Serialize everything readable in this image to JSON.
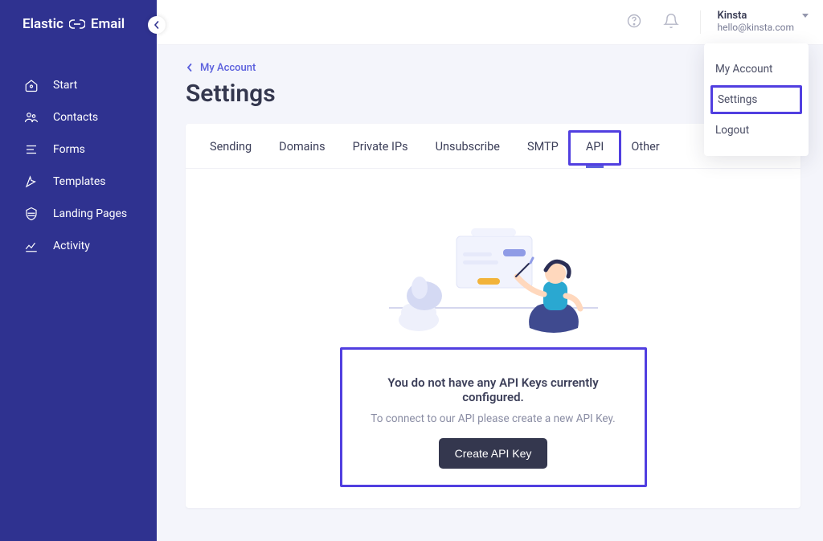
{
  "brand": {
    "name_a": "Elastic",
    "name_b": "Email"
  },
  "sidebar": {
    "items": [
      {
        "label": "Start",
        "icon": "home-icon"
      },
      {
        "label": "Contacts",
        "icon": "contacts-icon"
      },
      {
        "label": "Forms",
        "icon": "forms-icon"
      },
      {
        "label": "Templates",
        "icon": "templates-icon"
      },
      {
        "label": "Landing Pages",
        "icon": "landing-icon"
      },
      {
        "label": "Activity",
        "icon": "activity-icon"
      }
    ]
  },
  "breadcrumb": {
    "label": "My Account"
  },
  "page": {
    "title": "Settings"
  },
  "tabs": [
    {
      "label": "Sending"
    },
    {
      "label": "Domains"
    },
    {
      "label": "Private IPs"
    },
    {
      "label": "Unsubscribe"
    },
    {
      "label": "SMTP"
    },
    {
      "label": "API",
      "active": true
    },
    {
      "label": "Other"
    }
  ],
  "empty": {
    "title": "You do not have any API Keys currently configured.",
    "subtitle": "To connect to our API please create a new API Key.",
    "button": "Create API Key"
  },
  "user": {
    "name": "Kinsta",
    "email": "hello@kinsta.com"
  },
  "dropdown": {
    "items": [
      {
        "label": "My Account"
      },
      {
        "label": "Settings",
        "highlight": true
      },
      {
        "label": "Logout"
      }
    ]
  },
  "colors": {
    "accent": "#513fe0",
    "sidebar_bg": "#2f3290"
  }
}
